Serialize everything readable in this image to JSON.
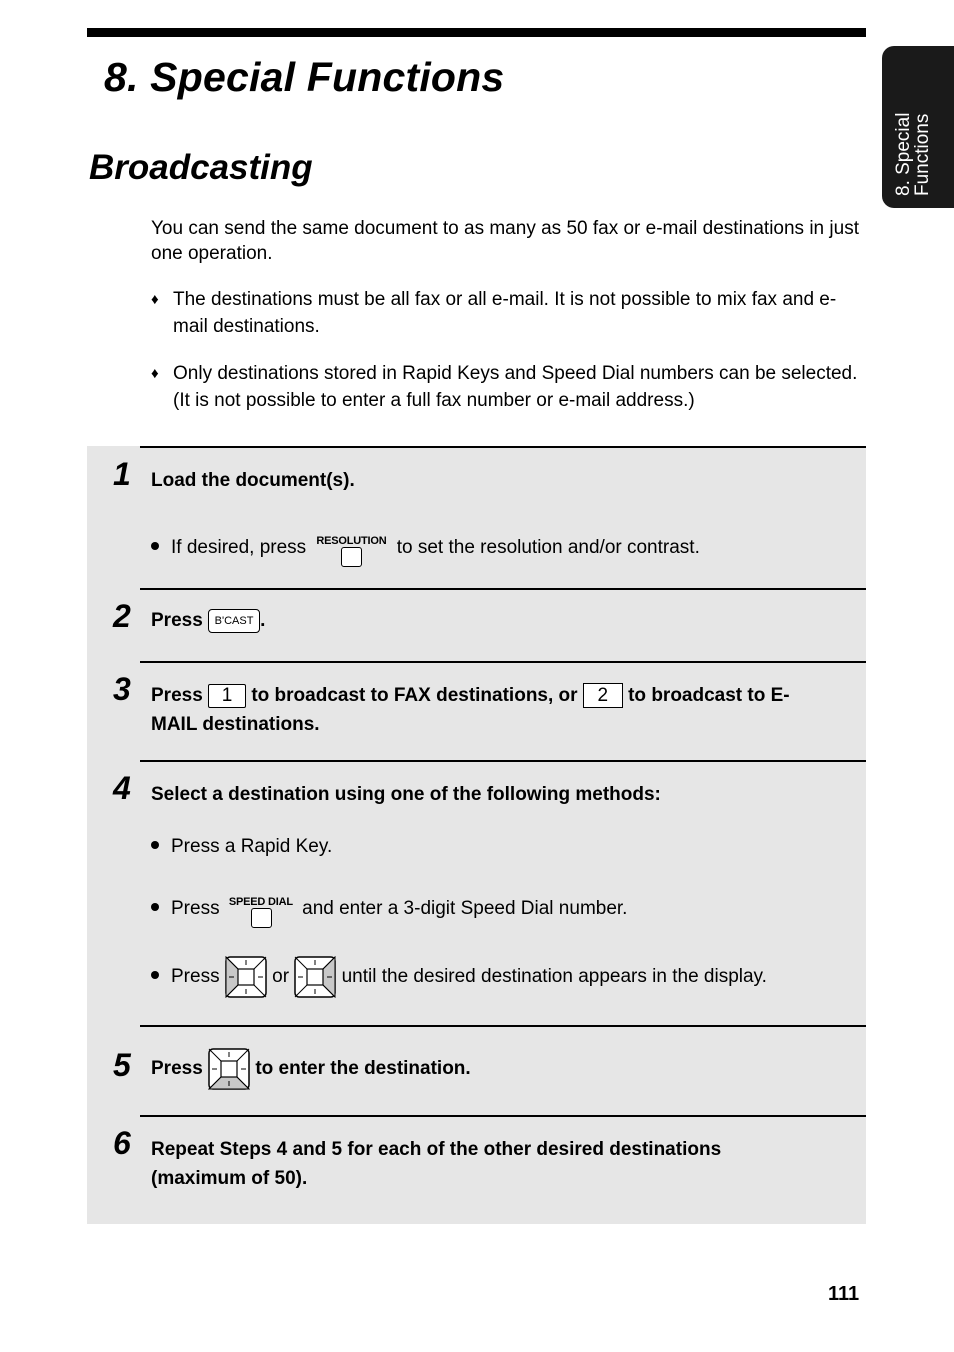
{
  "chapter_title": "8.  Special Functions",
  "side_tab": {
    "line1": "8. Special",
    "line2": "Functions"
  },
  "section_title": "Broadcasting",
  "intro": {
    "paragraph": "You can send the same document to as many as 50 fax or e-mail destinations in just one operation.",
    "notes": [
      "The destinations must be all fax or all e-mail. It is not possible to mix fax and e-mail destinations.",
      "Only destinations stored in Rapid Keys and Speed Dial numbers can be selected. (It is not possible to enter a full fax number or e-mail address.)"
    ],
    "note_marker": "♦"
  },
  "steps": [
    {
      "number": "1",
      "text": "Load the document(s).",
      "bullet": {
        "before": "If desired, press",
        "key_label": "RESOLUTION",
        "after": "to set the resolution and/or contrast."
      }
    },
    {
      "number": "2",
      "press": "Press",
      "key": "B'CAST",
      "after": "."
    },
    {
      "number": "3",
      "press": "Press",
      "key1": "1",
      "middle": "to broadcast to FAX destinations, or",
      "key2": "2",
      "after_line1": "to broadcast to E-",
      "after_line2": "MAIL destinations."
    },
    {
      "number": "4",
      "text": "Select a destination using one of the following methods:",
      "bullets": [
        {
          "text": "Press a Rapid Key."
        },
        {
          "before": "Press",
          "key_label": "SPEED DIAL",
          "after": "and enter a 3-digit Speed Dial number."
        },
        {
          "before": "Press",
          "or": "or",
          "after": "until the desired destination appears in the display.",
          "key1_icon": "nav-left-key",
          "key2_icon": "nav-right-key"
        }
      ]
    },
    {
      "number": "5",
      "press": "Press",
      "key_icon": "nav-enter-key",
      "after": "to enter the destination."
    },
    {
      "number": "6",
      "line1": "Repeat Steps 4 and 5 for each of the other desired destinations",
      "line2": "(maximum of 50)."
    }
  ],
  "colors": {
    "step_background": "#e6e6e6",
    "tab_background": "#1a1a1a",
    "key_shade": "#c8c8c8"
  },
  "page_number": "111"
}
